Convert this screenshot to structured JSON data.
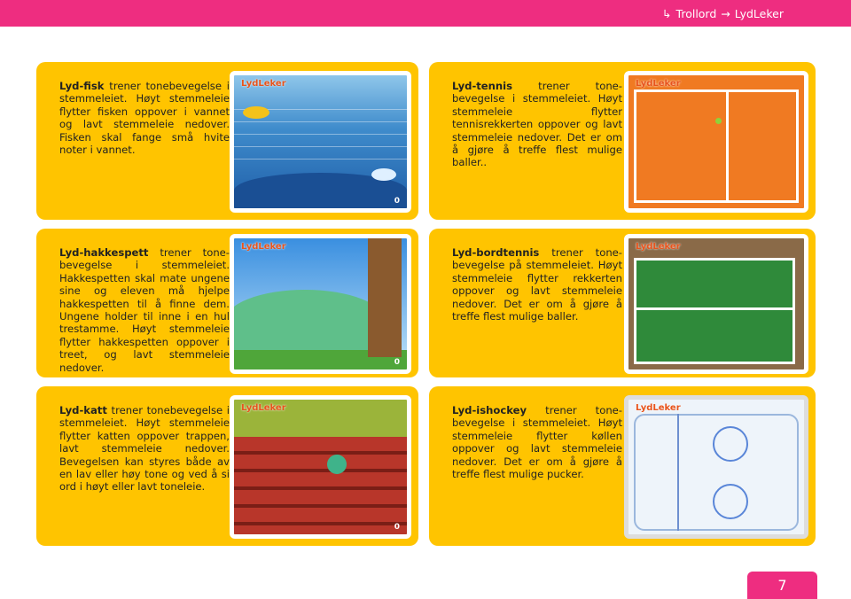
{
  "breadcrumb": {
    "parent": "Trollord",
    "current": "LydLeker"
  },
  "games": [
    {
      "name": "Lyd-fisk",
      "text": " trener tonebevegelse i stemmeleiet. Høyt stemmeleie flytter fisken oppover i vannet og lavt stemmeleie nedover. Fisken skal fange små hvite noter i vannet.",
      "logo": "LydLeker",
      "score": "0"
    },
    {
      "name": "Lyd-tennis",
      "text": " trener tone-bevegelse i stemmeleiet. Høyt stemmeleie flytter tennisrekkerten oppover og lavt stemmeleie nedover. Det er om å gjøre å treffe flest mulige baller..",
      "logo": "LydLeker",
      "score": ""
    },
    {
      "name": "Lyd-hakkespett",
      "text": " trener tone-bevegelse i stemmeleiet. Hakkespetten skal mate ungene sine og eleven må hjelpe hakkespetten til å finne dem. Ungene holder til inne i en hul trestamme. Høyt stemmeleie flytter hakkespetten oppover i treet, og lavt stemmeleie nedover.",
      "logo": "LydLeker",
      "score": "0"
    },
    {
      "name": "Lyd-bordtennis",
      "text": " trener tone-bevegelse på stemmeleiet. Høyt stemmeleie flytter rekkerten oppover og lavt stemmeleie nedover. Det er om å gjøre å treffe flest mulige baller.",
      "logo": "LydLeker",
      "score": ""
    },
    {
      "name": "Lyd-katt",
      "text": " trener tonebevegelse i stemmeleiet. Høyt stemmeleie flytter katten oppover trappen, lavt stemmeleie nedover. Bevegelsen kan styres både av en lav eller høy tone og ved å si ord i høyt eller lavt toneleie.",
      "logo": "LydLeker",
      "score": "0"
    },
    {
      "name": "Lyd-ishockey",
      "text": " trener tone-bevegelse i stemmeleiet. Høyt stemmeleie flytter køllen oppover og lavt stemmeleie nedover. Det er om å gjøre å treffe flest mulige pucker.",
      "logo": "LydLeker",
      "score": ""
    }
  ],
  "page_number": "7",
  "colors": {
    "accent": "#ee2d80",
    "card": "#ffc400"
  }
}
